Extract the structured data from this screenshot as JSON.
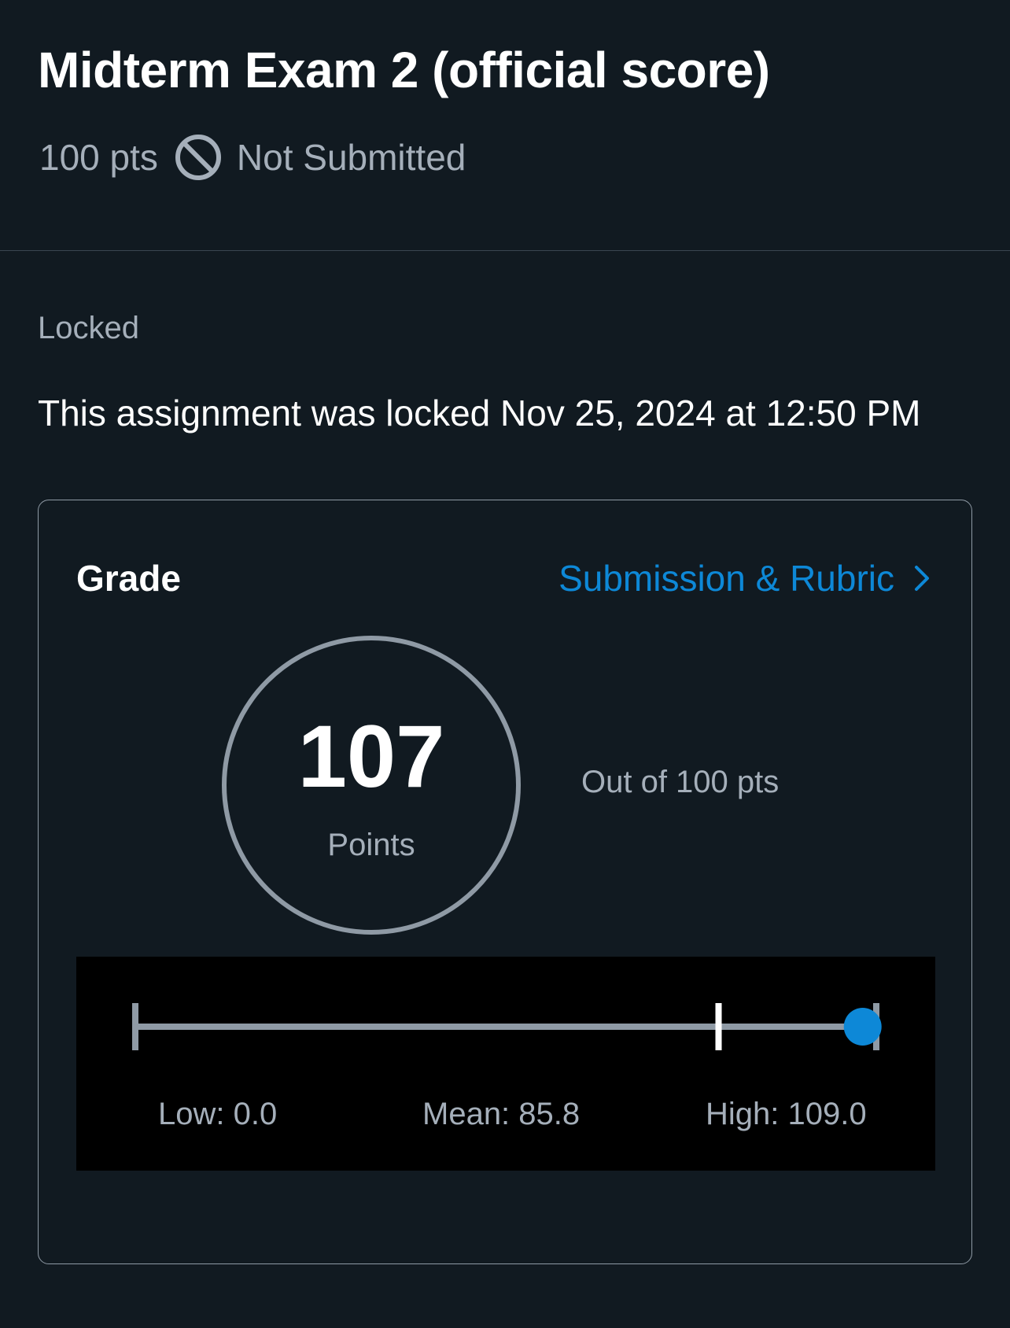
{
  "assignment": {
    "title": "Midterm Exam 2 (official score)",
    "points_possible": "100 pts",
    "submission_status": "Not Submitted",
    "status_icon": "no-entry-icon"
  },
  "lock": {
    "label": "Locked",
    "message": "This assignment was locked Nov 25, 2024 at 12:50 PM"
  },
  "grade": {
    "label": "Grade",
    "link_label": "Submission & Rubric",
    "link_icon": "chevron-right-icon",
    "score": "107",
    "score_unit": "Points",
    "out_of": "Out of 100 pts"
  },
  "stats": {
    "low_label": "Low: 0.0",
    "mean_label": "Mean: 85.8",
    "high_label": "High: 109.0",
    "low": 0.0,
    "mean": 85.8,
    "high": 109.0,
    "user_score": 107
  },
  "colors": {
    "background": "#111a21",
    "accent": "#0d88d7",
    "muted_text": "#a5afba",
    "circle_stroke": "#8f9aa5"
  }
}
